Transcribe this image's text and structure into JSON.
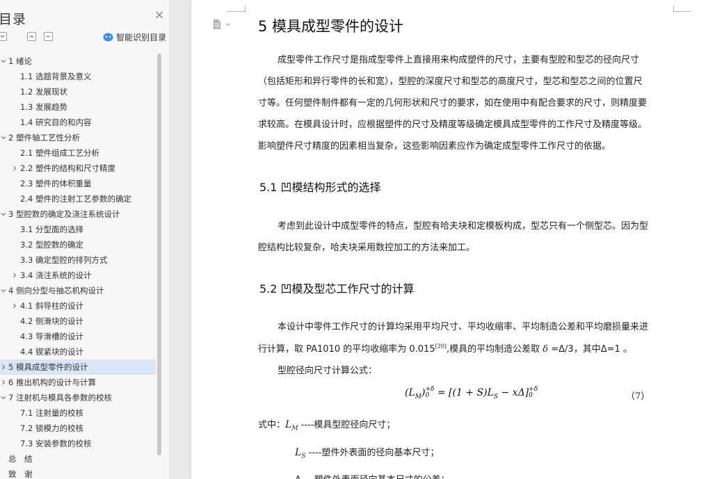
{
  "nav": {
    "title": "目录",
    "close_glyph": "×",
    "smart_toc_label": "智能识别目录",
    "items": [
      {
        "label": "1 绪论",
        "level": 1,
        "expander": "expanded"
      },
      {
        "label": "1.1 选题背景及意义",
        "level": 2,
        "expander": "none"
      },
      {
        "label": "1.2 发展现状",
        "level": 2,
        "expander": "none"
      },
      {
        "label": "1.3 发展趋势",
        "level": 2,
        "expander": "none"
      },
      {
        "label": "1.4 研究目的和内容",
        "level": 2,
        "expander": "none"
      },
      {
        "label": "2 塑件轴工艺性分析",
        "level": 1,
        "expander": "expanded"
      },
      {
        "label": "2.1 塑件组成工艺分析",
        "level": 2,
        "expander": "none"
      },
      {
        "label": "2.2 塑件的结构和尺寸精度",
        "level": 2,
        "expander": "collapsed"
      },
      {
        "label": "2.3 塑件的体积重量",
        "level": 2,
        "expander": "none"
      },
      {
        "label": "2.4 塑件的注射工艺参数的确定",
        "level": 2,
        "expander": "none"
      },
      {
        "label": "3 型腔数的确定及浇注系统设计",
        "level": 1,
        "expander": "expanded"
      },
      {
        "label": "3.1 分型面的选择",
        "level": 2,
        "expander": "none"
      },
      {
        "label": "3.2 型腔数的确定",
        "level": 2,
        "expander": "none"
      },
      {
        "label": "3.3 确定型腔的排列方式",
        "level": 2,
        "expander": "none"
      },
      {
        "label": "3.4 浇注系统的设计",
        "level": 2,
        "expander": "collapsed"
      },
      {
        "label": "4 侧向分型与抽芯机构设计",
        "level": 1,
        "expander": "expanded"
      },
      {
        "label": "4.1 斜导柱的设计",
        "level": 2,
        "expander": "collapsed"
      },
      {
        "label": "4.2 侧滑块的设计",
        "level": 2,
        "expander": "none"
      },
      {
        "label": "4.3 导滑槽的设计",
        "level": 2,
        "expander": "none"
      },
      {
        "label": "4.4 锲紧块的设计",
        "level": 2,
        "expander": "none"
      },
      {
        "label": "5 模具成型零件的设计",
        "level": 1,
        "expander": "collapsed",
        "active": true
      },
      {
        "label": "6 推出机构的设计与计算",
        "level": 1,
        "expander": "collapsed"
      },
      {
        "label": "7 注射机与模具各参数的校核",
        "level": 1,
        "expander": "expanded"
      },
      {
        "label": "7.1 注射量的校核",
        "level": 2,
        "expander": "none"
      },
      {
        "label": "7.2 锁模力的校核",
        "level": 2,
        "expander": "none"
      },
      {
        "label": "7.3 安装参数的校核",
        "level": 2,
        "expander": "none"
      },
      {
        "label": "总　结",
        "level": 0,
        "expander": "none"
      },
      {
        "label": "致　谢",
        "level": 0,
        "expander": "none"
      }
    ],
    "active_color": "#d9e6f7"
  },
  "document": {
    "chapter_title": "5 模具成型零件的设计",
    "intro_lines": [
      "成型零件工作尺寸是指成型零件上直接用来构成塑件的尺寸，主要有型腔和型芯的径向尺寸",
      "（包括矩形和异行零件的长和宽），型腔的深度尺寸和型芯的高度尺寸，型芯和型芯之间的位置尺",
      "寸等。任何塑件制件都有一定的几何形状和尺寸的要求，如在使用中有配合要求的尺寸，则精度要",
      "求较高。在模具设计时，应根据塑件的尺寸及精度等级确定模具成型零件的工作尺寸及精度等级。",
      "影响塑件尺寸精度的因素相当复杂，这些影响因素应作为确定成型零件工作尺寸的依据。"
    ],
    "section1_title": "5.1 凹模结构形式的选择",
    "section1_lines": [
      "考虑到此设计中成型零件的特点，型腔有哈夫块和定模板构成，型芯只有一个侧型芯。因为型",
      "腔结构比较复杂，哈夫块采用数控加工的方法来加工。"
    ],
    "section2_title": "5.2 凹模及型芯工作尺寸的计算",
    "section2_line1": "本设计中零件工作尺寸的计算均采用平均尺寸、平均收缩率、平均制造公差和平均磨损量来进",
    "section2_line2_a": "行计算，取 PA1010 的平均收缩率为 0.015",
    "section2_ref": "[20]",
    "section2_line2_b": ",模具的平均制造公差取 ",
    "delta_var": "δ",
    "section2_line2_c": " =Δ/3，其中Δ=1 。",
    "formula_intro": "型腔径向尺寸计算公式：",
    "formula_lhs": "(L",
    "formula_lhs_sub": "M",
    "formula_lhs_close": ")",
    "formula_lhs_sup": "+δ",
    "formula_lhs_sub2": "0",
    "formula_rhs": " = [(1 + S)L",
    "formula_rhs_sub": "S",
    "formula_rhs_tail": " − xΔ]",
    "formula_rhs_sup": "+δ",
    "formula_rhs_sub2": "0",
    "equation_number": "（7）",
    "where_prefix": "式中：",
    "var1_symbol": "L",
    "var1_sub": "M",
    "var1_desc": " ----模具型腔径向尺寸；",
    "var2_symbol": "L",
    "var2_sub": "S",
    "var2_desc": " ----塑件外表面的径向基本尺寸；",
    "var3_partial": "Δ----塑件外表面径向基本尺寸的公差；"
  }
}
